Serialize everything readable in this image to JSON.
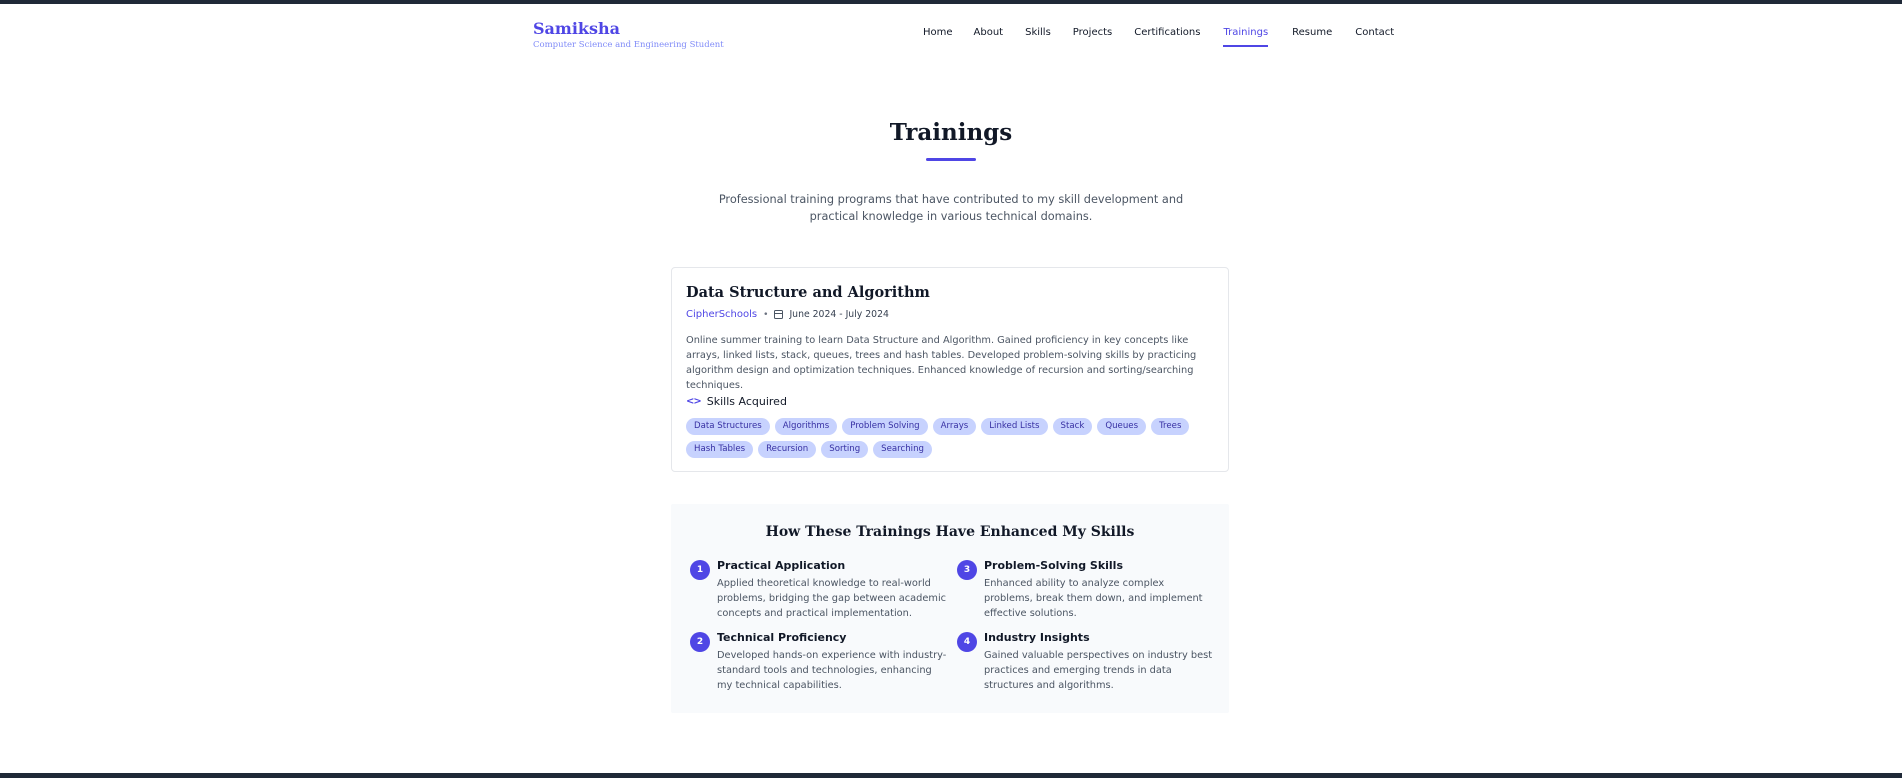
{
  "brand": {
    "name": "Samiksha",
    "subtitle": "Computer Science and Engineering Student"
  },
  "nav": {
    "items": [
      "Home",
      "About",
      "Skills",
      "Projects",
      "Certifications",
      "Trainings",
      "Resume",
      "Contact"
    ],
    "active": "Trainings"
  },
  "page": {
    "title": "Trainings",
    "intro": "Professional training programs that have contributed to my skill development and practical knowledge in various technical domains."
  },
  "training": {
    "title": "Data Structure and Algorithm",
    "organization": "CipherSchools",
    "separator": "•",
    "date": "June 2024 - July 2024",
    "description": "Online summer training to learn Data Structure and Algorithm. Gained proficiency in key concepts like arrays, linked lists, stack, queues, trees and hash tables. Developed problem-solving skills by practicing algorithm design and optimization techniques. Enhanced knowledge of recursion and sorting/searching techniques.",
    "skills_heading": "Skills Acquired",
    "skills": [
      "Data Structures",
      "Algorithms",
      "Problem Solving",
      "Arrays",
      "Linked Lists",
      "Stack",
      "Queues",
      "Trees",
      "Hash Tables",
      "Recursion",
      "Sorting",
      "Searching"
    ]
  },
  "enhanced": {
    "title": "How These Trainings Have Enhanced My Skills",
    "points": [
      {
        "num": "1",
        "title": "Practical Application",
        "text": "Applied theoretical knowledge to real-world problems, bridging the gap between academic concepts and practical implementation."
      },
      {
        "num": "2",
        "title": "Technical Proficiency",
        "text": "Developed hands-on experience with industry-standard tools and technologies, enhancing my technical capabilities."
      },
      {
        "num": "3",
        "title": "Problem-Solving Skills",
        "text": "Enhanced ability to analyze complex problems, break them down, and implement effective solutions."
      },
      {
        "num": "4",
        "title": "Industry Insights",
        "text": "Gained valuable perspectives on industry best practices and emerging trends in data structures and algorithms."
      }
    ]
  },
  "colors": {
    "accent": "#4f46e5",
    "tag_bg": "#c7d2fe",
    "section_bg": "#f8fafc"
  }
}
